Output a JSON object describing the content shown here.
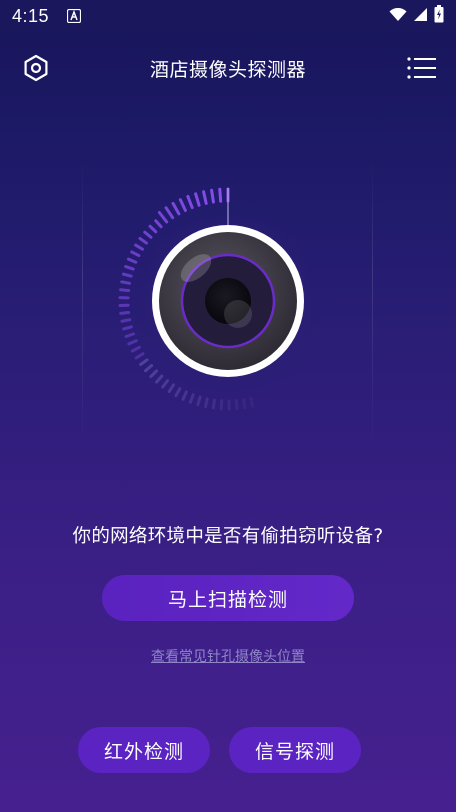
{
  "status_bar": {
    "time": "4:15",
    "icons": [
      "a-icon",
      "wifi-icon",
      "signal-icon",
      "battery-icon"
    ]
  },
  "header": {
    "title": "酒店摄像头探测器",
    "left_icon": "settings-hexagon-icon",
    "right_icon": "menu-list-icon"
  },
  "main": {
    "question": "你的网络环境中是否有偷拍窃听设备?",
    "scan_button": "马上扫描检测",
    "pinhole_link": "查看常见针孔摄像头位置"
  },
  "bottom": {
    "infrared_button": "红外检测",
    "signal_button": "信号探测"
  },
  "colors": {
    "accent": "#5a23c2",
    "tick_active": "#8b4ff0",
    "background_top": "#17155a",
    "background_bottom": "#46208f"
  }
}
